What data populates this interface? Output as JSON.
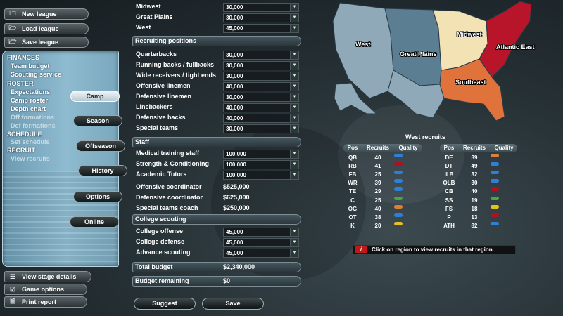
{
  "sidebar": {
    "top_buttons": [
      {
        "label": "New league",
        "icon": "folder-icon"
      },
      {
        "label": "Load league",
        "icon": "folder-open-icon"
      },
      {
        "label": "Save league",
        "icon": "folder-save-icon"
      }
    ],
    "menu": [
      {
        "label": "FINANCES",
        "kind": "hdr"
      },
      {
        "label": "Team budget",
        "kind": "link"
      },
      {
        "label": "Scouting service",
        "kind": "link"
      },
      {
        "label": "ROSTER",
        "kind": "hdr"
      },
      {
        "label": "Expectations",
        "kind": "link"
      },
      {
        "label": "Camp roster",
        "kind": "link"
      },
      {
        "label": "Depth chart",
        "kind": "link"
      },
      {
        "label": "Off formations",
        "kind": "dim"
      },
      {
        "label": "Def formations",
        "kind": "dim"
      },
      {
        "label": "SCHEDULE",
        "kind": "hdr"
      },
      {
        "label": "Set schedule",
        "kind": "dim"
      },
      {
        "label": "RECRUIT",
        "kind": "hdr"
      },
      {
        "label": "View recruits",
        "kind": "dim"
      }
    ],
    "stages": [
      "Camp",
      "Season",
      "Offseason",
      "History",
      "Options",
      "Online"
    ],
    "active_stage": "Camp",
    "bottom_buttons": [
      {
        "label": "View stage details",
        "icon": "list-icon"
      },
      {
        "label": "Game options",
        "icon": "checkbox-icon"
      },
      {
        "label": "Print report",
        "icon": "document-icon"
      }
    ]
  },
  "budget": {
    "region_rows": [
      {
        "label": "Midwest",
        "value": "30,000"
      },
      {
        "label": "Great Plains",
        "value": "30,000"
      },
      {
        "label": "West",
        "value": "45,000"
      }
    ],
    "recruiting_header": "Recruiting positions",
    "recruiting_rows": [
      {
        "label": "Quarterbacks",
        "value": "30,000"
      },
      {
        "label": "Running backs / fullbacks",
        "value": "30,000"
      },
      {
        "label": "Wide receivers / tight ends",
        "value": "30,000"
      },
      {
        "label": "Offensive linemen",
        "value": "40,000"
      },
      {
        "label": "Defensive linemen",
        "value": "30,000"
      },
      {
        "label": "Linebackers",
        "value": "40,000"
      },
      {
        "label": "Defensive backs",
        "value": "40,000"
      },
      {
        "label": "Special teams",
        "value": "30,000"
      }
    ],
    "staff_header": "Staff",
    "staff_dropdown_rows": [
      {
        "label": "Medical training staff",
        "value": "100,000"
      },
      {
        "label": "Strength & Conditioning",
        "value": "100,000"
      },
      {
        "label": "Academic Tutors",
        "value": "100,000"
      }
    ],
    "staff_static_rows": [
      {
        "label": "Offensive coordinator",
        "value": "$525,000"
      },
      {
        "label": "Defensive coordinator",
        "value": "$625,000"
      },
      {
        "label": "Special teams coach",
        "value": "$250,000"
      }
    ],
    "scouting_header": "College scouting",
    "scouting_rows": [
      {
        "label": "College offense",
        "value": "45,000"
      },
      {
        "label": "College defense",
        "value": "45,000"
      },
      {
        "label": "Advance scouting",
        "value": "45,000"
      }
    ],
    "total_label": "Total budget",
    "total_value": "$2,340,000",
    "remaining_label": "Budget remaining",
    "remaining_value": "$0",
    "suggest_label": "Suggest",
    "save_label": "Save"
  },
  "map": {
    "regions": [
      {
        "name": "West",
        "color": "#8fa9b8"
      },
      {
        "name": "Great Plains",
        "color": "#5c7e93"
      },
      {
        "name": "Midwest",
        "color": "#f3e3b4"
      },
      {
        "name": "Atlantic East",
        "color": "#b8142a"
      },
      {
        "name": "Southeast",
        "color": "#e0733c"
      }
    ]
  },
  "recruits": {
    "title": "West recruits",
    "headers": [
      "Pos",
      "Recruits",
      "Quality"
    ],
    "left": [
      {
        "pos": "QB",
        "count": "40",
        "quality": "#2f7fd6"
      },
      {
        "pos": "RB",
        "count": "41",
        "quality": "#b01020"
      },
      {
        "pos": "FB",
        "count": "25",
        "quality": "#2f7fd6"
      },
      {
        "pos": "WR",
        "count": "39",
        "quality": "#2f7fd6"
      },
      {
        "pos": "TE",
        "count": "29",
        "quality": "#2f7fd6"
      },
      {
        "pos": "C",
        "count": "25",
        "quality": "#4aa44a"
      },
      {
        "pos": "OG",
        "count": "40",
        "quality": "#d9803a"
      },
      {
        "pos": "OT",
        "count": "38",
        "quality": "#2f7fd6"
      },
      {
        "pos": "K",
        "count": "20",
        "quality": "#e3c21e"
      }
    ],
    "right": [
      {
        "pos": "DE",
        "count": "39",
        "quality": "#d9803a"
      },
      {
        "pos": "DT",
        "count": "49",
        "quality": "#2f7fd6"
      },
      {
        "pos": "ILB",
        "count": "32",
        "quality": "#2f7fd6"
      },
      {
        "pos": "OLB",
        "count": "30",
        "quality": "#2f7fd6"
      },
      {
        "pos": "CB",
        "count": "40",
        "quality": "#b01020"
      },
      {
        "pos": "SS",
        "count": "19",
        "quality": "#4aa44a"
      },
      {
        "pos": "FS",
        "count": "18",
        "quality": "#e3c21e"
      },
      {
        "pos": "P",
        "count": "13",
        "quality": "#b01020"
      },
      {
        "pos": "ATH",
        "count": "82",
        "quality": "#2f7fd6"
      }
    ],
    "hint": "Click on region to view recruits in that region."
  }
}
